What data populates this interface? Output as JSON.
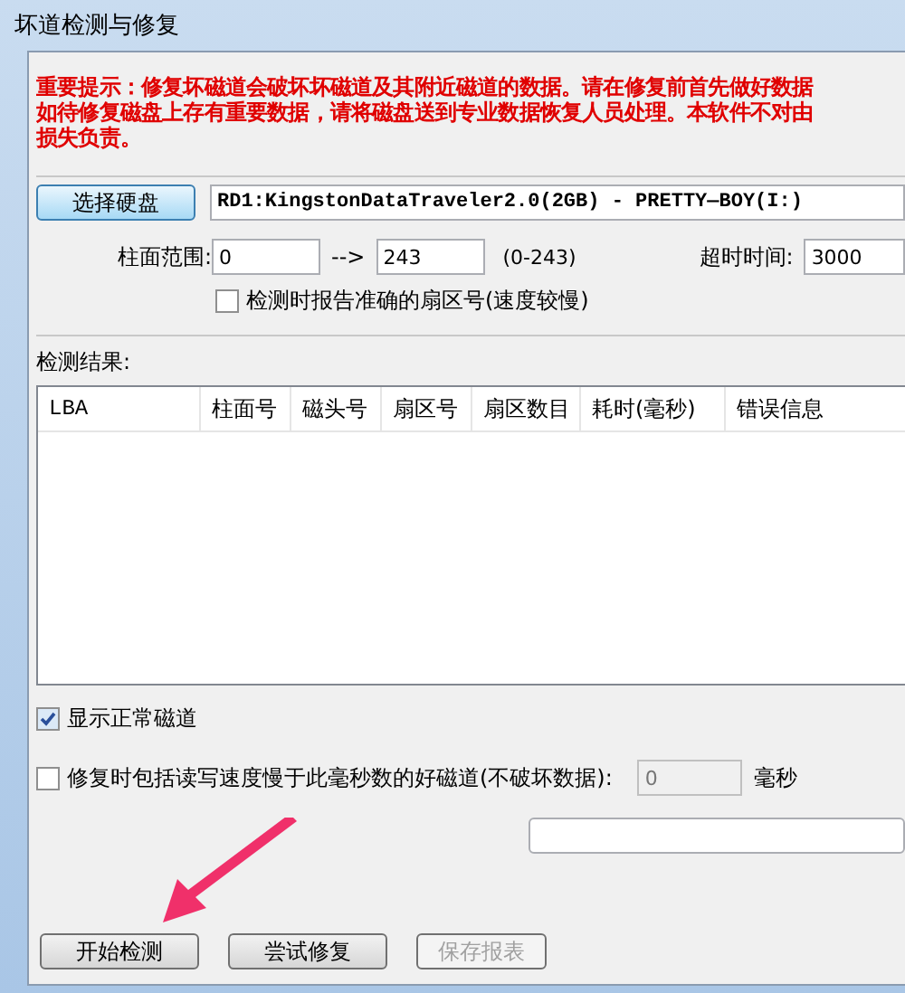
{
  "window": {
    "title": "坏道检测与修复"
  },
  "notice": [
    "重要提示：修复坏磁道会破坏坏磁道及其附近磁道的数据。请在修复前首先做好数据",
    "如待修复磁盘上存有重要数据，请将磁盘送到专业数据恢复人员处理。本软件不对由",
    "损失负责。"
  ],
  "disk": {
    "button": "选择硬盘",
    "value": "RD1:KingstonDataTraveler2.0(2GB) - PRETTY—BOY(I:)"
  },
  "range": {
    "label": "柱面范围:",
    "from": "0",
    "arrow": "-->",
    "to": "243",
    "hint": "(0-243)",
    "timeout_label": "超时时间:",
    "timeout": "3000"
  },
  "exact_sector": {
    "label": "检测时报告准确的扇区号(速度较慢)",
    "checked": false
  },
  "results": {
    "label": "检测结果:",
    "columns": [
      "LBA",
      "柱面号",
      "磁头号",
      "扇区号",
      "扇区数目",
      "耗时(毫秒)",
      "错误信息"
    ]
  },
  "show_normal": {
    "label": "显示正常磁道",
    "checked": true
  },
  "include_slow": {
    "label": "修复时包括读写速度慢于此毫秒数的好磁道(不破坏数据):",
    "checked": false,
    "value": "0",
    "unit": "毫秒"
  },
  "buttons": [
    {
      "label": "开始检测",
      "disabled": false
    },
    {
      "label": "尝试修复",
      "disabled": false
    },
    {
      "label": "保存报表",
      "disabled": true
    }
  ]
}
